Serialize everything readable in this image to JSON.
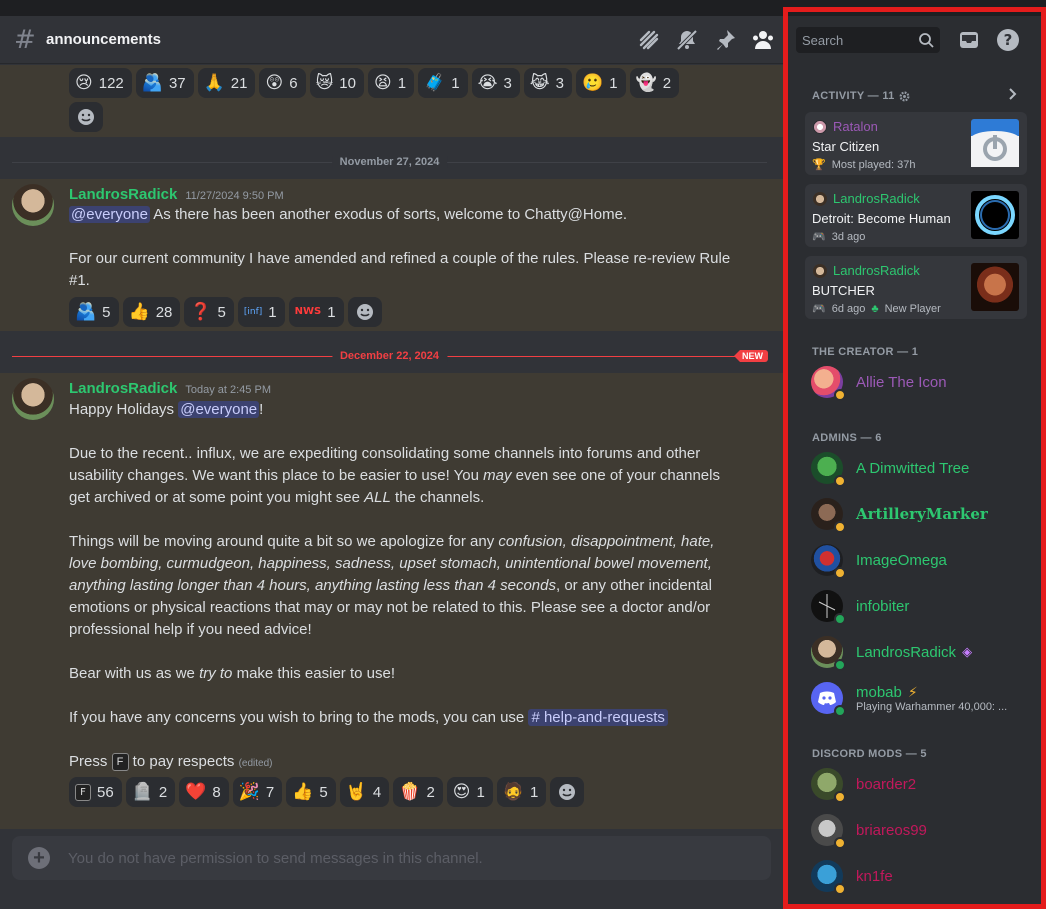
{
  "channel": {
    "name": "announcements"
  },
  "header_icons": [
    "threads-icon",
    "mute-icon",
    "pin-icon",
    "members-icon"
  ],
  "top_reactions": [
    {
      "emoji": "😢",
      "count": "122"
    },
    {
      "emoji": "🫂",
      "count": "37"
    },
    {
      "emoji": "🙏",
      "count": "21"
    },
    {
      "emoji": "😲",
      "count": "6"
    },
    {
      "emoji": "😿",
      "count": "10"
    },
    {
      "emoji": "😫",
      "count": "1"
    },
    {
      "emoji": "🧳",
      "count": "1"
    },
    {
      "emoji": "😭",
      "count": "3"
    },
    {
      "emoji": "😹",
      "count": "3"
    },
    {
      "emoji": "🥲",
      "count": "1"
    },
    {
      "emoji": "👻",
      "count": "2"
    }
  ],
  "dividers": {
    "first": "November 27, 2024",
    "second": "December 22, 2024",
    "new_tag": "NEW"
  },
  "message1": {
    "author": "LandrosRadick",
    "timestamp": "11/27/2024 9:50 PM",
    "mention": "@everyone",
    "line1": " As there has been another exodus of sorts, welcome to Chatty@Home.",
    "line2": "For our current community I have amended and refined a couple of the rules. Please re-review Rule #1.",
    "reactions": [
      {
        "emoji": "🫂",
        "count": "5"
      },
      {
        "emoji": "👍",
        "count": "28"
      },
      {
        "emoji": "❓",
        "count": "5"
      },
      {
        "emoji": "[inf]",
        "count": "1"
      },
      {
        "emoji": "NWS",
        "count": "1"
      }
    ]
  },
  "message2": {
    "author": "LandrosRadick",
    "timestamp": "Today at 2:45 PM",
    "greeting": "Happy Holidays ",
    "mention": "@everyone",
    "p1a": "Due to the recent.. influx, we are expediting consolidating some channels into forums and other usability changes. We want this place to be easier to use!  You ",
    "p1b": "may",
    "p1c": " even see one of your channels get archived or at some point you might see ",
    "p1d": "ALL",
    "p1e": " the channels.",
    "p2a": "Things will be moving around quite a bit so we apologize for any ",
    "p2b": "confusion, disappointment, hate, love bombing, curmudgeon, happiness, sadness, upset stomach, unintentional bowel movement, anything lasting longer than 4 hours, anything lasting less than 4 seconds",
    "p2c": ", or any other incidental emotions or physical reactions that may or may not be related to this. Please see a doctor and/or professional help if you need advice!",
    "p3a": "Bear with us as we ",
    "p3b": "try to",
    "p3c": " make this easier to use!",
    "p4": "If you have any concerns you wish to bring to the mods, you can use ",
    "p4_channel": "# help-and-requests",
    "p5a": "Press ",
    "p5b": " to pay respects ",
    "edited": "(edited)",
    "reactions": [
      {
        "emoji": "F",
        "count": "56"
      },
      {
        "emoji": "🪦",
        "count": "2"
      },
      {
        "emoji": "❤️",
        "count": "8"
      },
      {
        "emoji": "🎉",
        "count": "7"
      },
      {
        "emoji": "👍",
        "count": "5"
      },
      {
        "emoji": "🤘",
        "count": "4"
      },
      {
        "emoji": "🍿",
        "count": "2"
      },
      {
        "emoji": "😍",
        "count": "1"
      },
      {
        "emoji": "🧔",
        "count": "1"
      }
    ]
  },
  "composer": {
    "placeholder": "You do not have permission to send messages in this channel."
  },
  "sidebar": {
    "search_placeholder": "Search",
    "activity_title": "ACTIVITY — 11",
    "activities": [
      {
        "user": "Ratalon",
        "game": "Star Citizen",
        "meta": "Most played: 37h",
        "extra": ""
      },
      {
        "user": "LandrosRadick",
        "game": "Detroit: Become Human",
        "meta": "3d ago",
        "extra": ""
      },
      {
        "user": "LandrosRadick",
        "game": "BUTCHER",
        "meta": "6d ago",
        "extra": "New Player"
      }
    ],
    "creator_title": "THE CREATOR — 1",
    "creator": [
      {
        "name": "Allie The Icon"
      }
    ],
    "admins_title": "ADMINS — 6",
    "admins": [
      {
        "name": "A Dimwitted Tree",
        "sub": ""
      },
      {
        "name": "ArtilleryMarker",
        "sub": ""
      },
      {
        "name": "ImageOmega",
        "sub": ""
      },
      {
        "name": "infobiter",
        "sub": ""
      },
      {
        "name": "LandrosRadick",
        "sub": ""
      },
      {
        "name": "mobab",
        "sub": "Playing Warhammer 40,000: ..."
      }
    ],
    "mods_title": "DISCORD MODS — 5",
    "mods": [
      {
        "name": "boarder2"
      },
      {
        "name": "briareos99"
      },
      {
        "name": "kn1fe"
      }
    ]
  }
}
